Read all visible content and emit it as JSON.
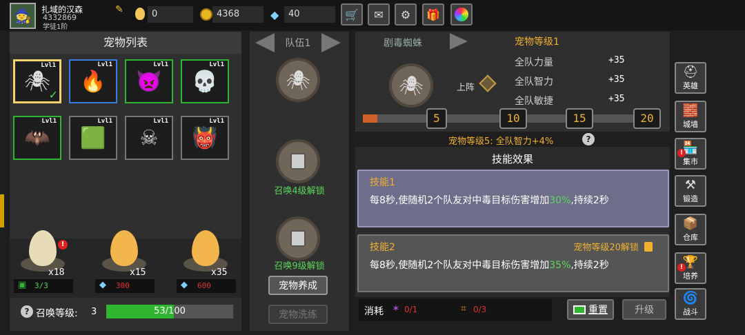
{
  "topbar": {
    "player_name": "扎域的汉森",
    "player_id": "4332869",
    "player_sub": "学徒1阶",
    "egg_count": "0",
    "gold": "4368",
    "gems": "40"
  },
  "pet_list": {
    "title": "宠物列表",
    "slots": [
      {
        "lvl": "Lvl1",
        "icon": "spider-pet-icon",
        "glyph": "🕷",
        "selected": true
      },
      {
        "lvl": "Lvl1",
        "icon": "flame-bat-pet-icon",
        "glyph": "🔥"
      },
      {
        "lvl": "Lvl1",
        "icon": "horned-slime-pet-icon",
        "glyph": "👿"
      },
      {
        "lvl": "Lvl1",
        "icon": "purple-skull-pet-icon",
        "glyph": "💀"
      },
      {
        "lvl": "Lvl1",
        "icon": "bat-pet-icon",
        "glyph": "🦇"
      },
      {
        "lvl": "Lvl1",
        "icon": "green-slime-pet-icon",
        "glyph": "🟩"
      },
      {
        "lvl": "Lvl1",
        "icon": "skeleton-pet-icon",
        "glyph": "☠"
      },
      {
        "lvl": "Lvl1",
        "icon": "dark-demon-pet-icon",
        "glyph": "👹"
      }
    ],
    "eggs": [
      {
        "count": "x18",
        "cost_icon": "video-icon",
        "cost": "3/3",
        "cost_color": "#5cd65c"
      },
      {
        "count": "x15",
        "cost_icon": "diamond-icon",
        "cost": "300",
        "cost_color": "#e03030"
      },
      {
        "count": "x35",
        "cost_icon": "diamond-icon",
        "cost": "600",
        "cost_color": "#e03030"
      }
    ],
    "summon_level_label": "召唤等级:",
    "summon_level": "3",
    "summon_progress_text": "53/100",
    "summon_progress": 0.53
  },
  "team": {
    "title": "队伍1",
    "unlock_4": "召唤4级解锁",
    "unlock_9": "召唤9级解锁",
    "cultivate": "宠物养成",
    "reset_wash": "宠物洗练"
  },
  "detail": {
    "pet_name": "剧毒蜘蛛",
    "deploy_label": "上阵",
    "pet_level": "宠物等级1",
    "stats": [
      {
        "name": "全队力量",
        "value": "+35"
      },
      {
        "name": "全队智力",
        "value": "+35"
      },
      {
        "name": "全队敏捷",
        "value": "+35"
      }
    ],
    "milestones": [
      "5",
      "10",
      "15",
      "20"
    ],
    "level_progress": 0.05,
    "bonus_text": "宠物等级5: 全队智力+4%",
    "skills_title": "技能效果",
    "skill1": {
      "name": "技能1",
      "desc_a": "每8秒,使随机2个队友对中毒目标伤害增加",
      "pct": "30%",
      "desc_b": ",持续2秒"
    },
    "skill2": {
      "name": "技能2",
      "unlock": "宠物等级20解锁",
      "desc_a": "每8秒,使随机2个队友对中毒目标伤害增加",
      "pct": "35%",
      "desc_b": ",持续2秒"
    },
    "cost_label": "消耗",
    "cost1": "0/1",
    "cost2": "0/3",
    "reset_label": "重置",
    "upgrade_label": "升级"
  },
  "sidebar": [
    {
      "label": "英雄",
      "icon": "helmet-icon",
      "glyph": "⛑"
    },
    {
      "label": "城墙",
      "icon": "wall-icon",
      "glyph": "🧱"
    },
    {
      "label": "集市",
      "icon": "market-icon",
      "glyph": "🏪"
    },
    {
      "label": "锻造",
      "icon": "anvil-icon",
      "glyph": "⚒"
    },
    {
      "label": "仓库",
      "icon": "warehouse-icon",
      "glyph": "📦"
    },
    {
      "label": "培养",
      "icon": "trophy-icon",
      "glyph": "🏆"
    },
    {
      "label": "战斗",
      "icon": "portal-icon",
      "glyph": "🌀"
    }
  ]
}
